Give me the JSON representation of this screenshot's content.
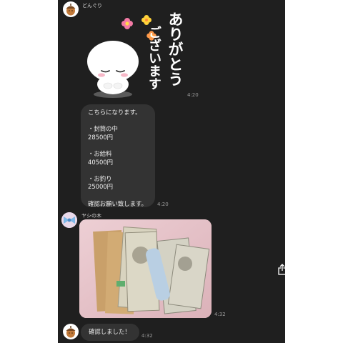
{
  "chat": {
    "sender1": {
      "name": "どんぐり",
      "avatar_icon": "acorn-icon",
      "sticker": {
        "text_line1": "ありがとう",
        "text_line2": "ございます",
        "time": "4:20"
      },
      "message": {
        "text": "こちらになります。\n\n・封筒の中\n28500円\n\n・お給料\n40500円\n\n・お釣り\n25000円\n\n確認お願い致します。",
        "time": "4:20"
      }
    },
    "sender2": {
      "name": "ヤシの木",
      "avatar_icon": "bow-icon",
      "photo": {
        "alt": "envelopes and banknotes photo",
        "time": "4:32"
      },
      "share_icon": "share-icon"
    },
    "sender1_reply": {
      "text": "確認しました！",
      "time": "4:32",
      "avatar_icon": "acorn-icon"
    }
  },
  "colors": {
    "background": "#1f1f1f",
    "bubble": "#333333",
    "text": "#f0f0f0",
    "time": "#9a9a9a"
  }
}
